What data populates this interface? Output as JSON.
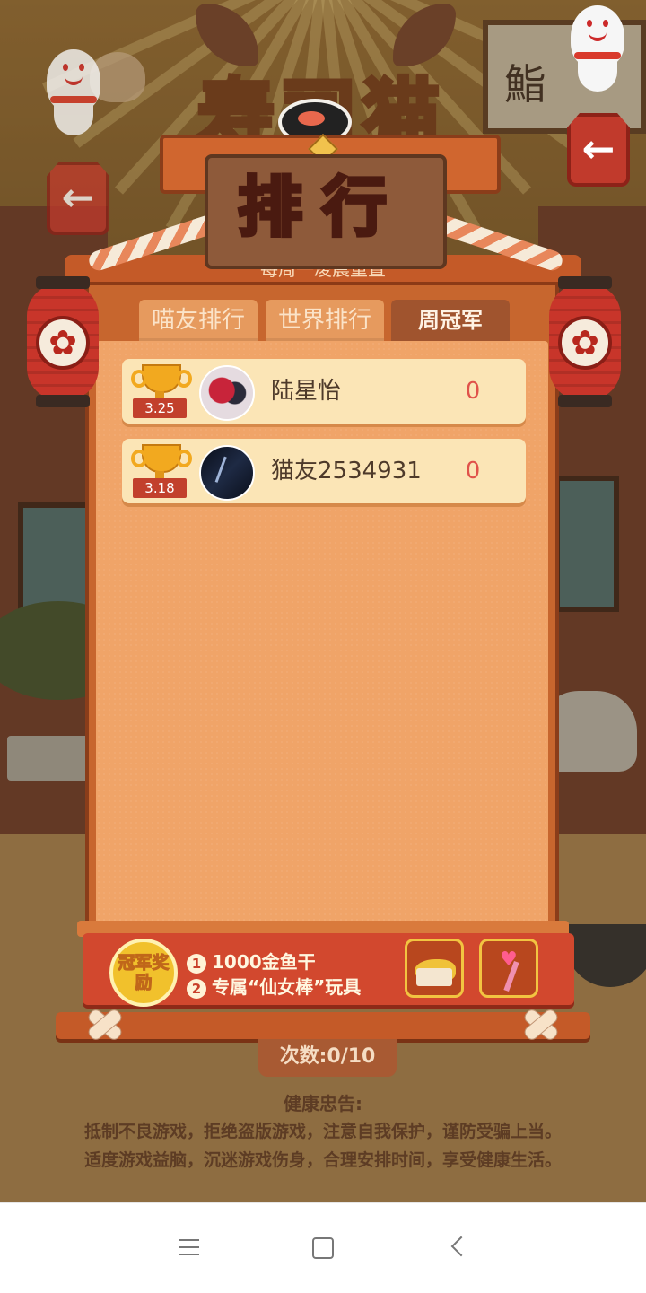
{
  "game": {
    "logo_text": "寿司猫",
    "sign_text": "鮨"
  },
  "ranking": {
    "title": "排行",
    "subtitle": "每周一凌晨重置",
    "tabs": [
      {
        "label": "喵友排行",
        "active": false
      },
      {
        "label": "世界排行",
        "active": false
      },
      {
        "label": "周冠军",
        "active": true
      }
    ],
    "rows": [
      {
        "date": "3.25",
        "name": "陆星怡",
        "score": "0"
      },
      {
        "date": "3.18",
        "name": "猫友2534931",
        "score": "0"
      }
    ]
  },
  "reward": {
    "medal_text": "冠军奖励",
    "item1_num": "1",
    "item1": "1000金鱼干",
    "item2_num": "2",
    "item2": "专属“仙女棒”玩具"
  },
  "count": "次数:0/10",
  "health": {
    "title": "健康忠告:",
    "line1": "抵制不良游戏，拒绝盗版游戏，注意自我保护，谨防受骗上当。",
    "line2": "适度游戏益脑，沉迷游戏伤身，合理安排时间，享受健康生活。"
  },
  "icons": {
    "back": "back-arrow-icon",
    "nav_menu": "menu-icon",
    "nav_home": "home-icon",
    "nav_back": "back-icon"
  },
  "colors": {
    "panel": "#f0a468",
    "row": "#fbe5b6",
    "score": "#e0524a",
    "banner": "#d2482e"
  }
}
